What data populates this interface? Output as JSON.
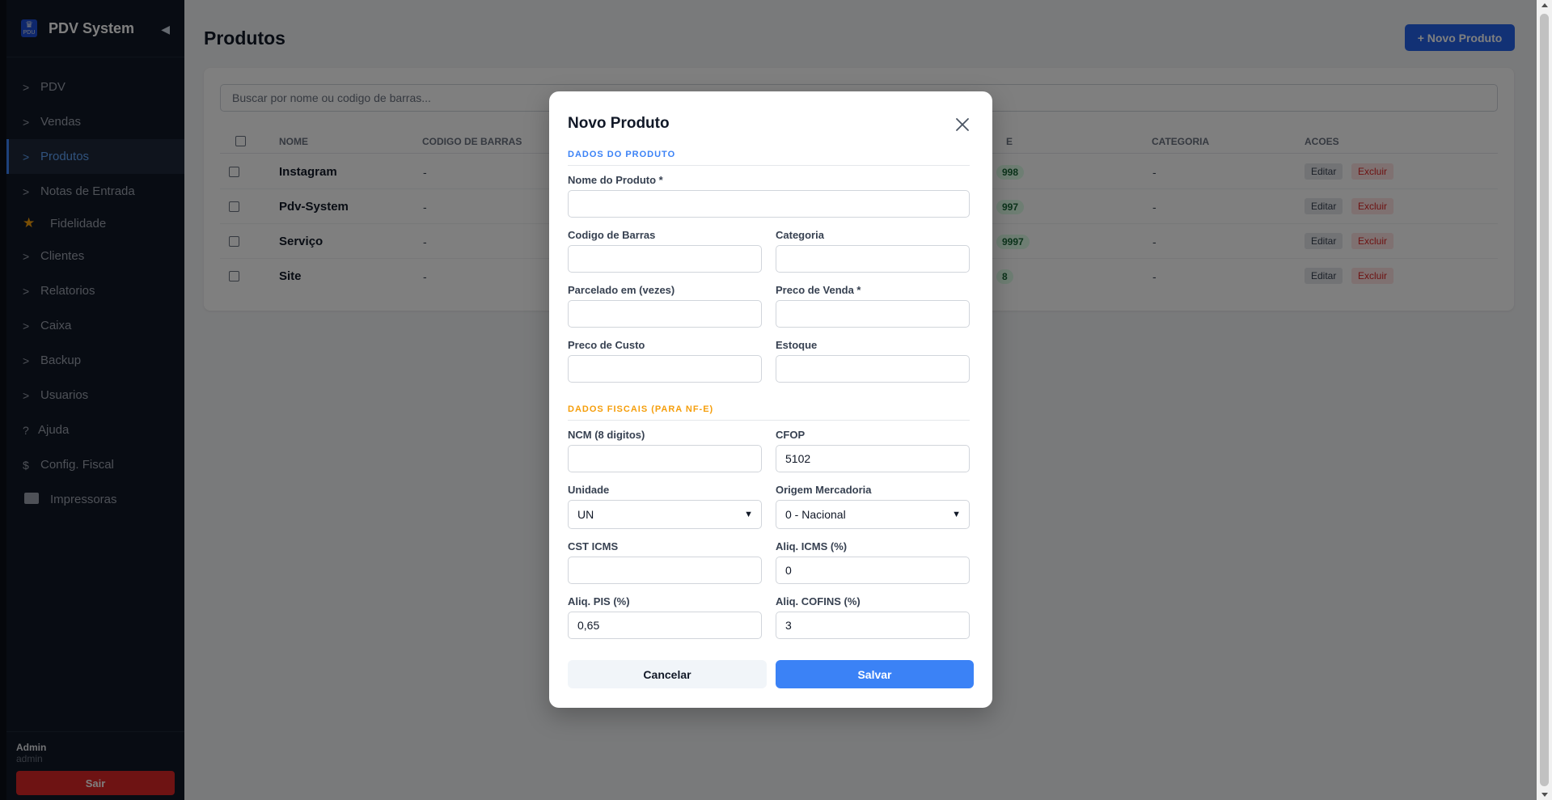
{
  "app": {
    "name": "PDV System",
    "logo_text": "PDU"
  },
  "sidebar": {
    "collapse_glyph": "◀",
    "items": [
      {
        "icon": ">",
        "label": "PDV"
      },
      {
        "icon": ">",
        "label": "Vendas"
      },
      {
        "icon": ">",
        "label": "Produtos",
        "active": true
      },
      {
        "icon": ">",
        "label": "Notas de Entrada"
      },
      {
        "icon": "★",
        "label": "Fidelidade"
      },
      {
        "icon": ">",
        "label": "Clientes"
      },
      {
        "icon": ">",
        "label": "Relatorios"
      },
      {
        "icon": ">",
        "label": "Caixa"
      },
      {
        "icon": ">",
        "label": "Backup"
      },
      {
        "icon": ">",
        "label": "Usuarios"
      },
      {
        "icon": "?",
        "label": "Ajuda"
      },
      {
        "icon": "$",
        "label": "Config. Fiscal"
      },
      {
        "icon": "printer-icon",
        "label": "Impressoras"
      }
    ],
    "user": {
      "name": "Admin",
      "role": "admin"
    },
    "logout_label": "Sair"
  },
  "main": {
    "title": "Produtos",
    "new_button": "+ Novo Produto",
    "search_placeholder": "Buscar por nome ou codigo de barras...",
    "columns": [
      "NOME",
      "CODIGO DE BARRAS",
      "E",
      "CATEGORIA",
      "ACOES"
    ],
    "rows": [
      {
        "name": "Instagram",
        "barcode": "-",
        "stock": "998",
        "category": "-"
      },
      {
        "name": "Pdv-System",
        "barcode": "-",
        "stock": "997",
        "category": "-"
      },
      {
        "name": "Serviço",
        "barcode": "-",
        "stock": "9997",
        "category": "-"
      },
      {
        "name": "Site",
        "barcode": "-",
        "stock": "8",
        "category": "-"
      }
    ],
    "edit_label": "Editar",
    "delete_label": "Excluir"
  },
  "modal": {
    "title": "Novo Produto",
    "section_product": "DADOS DO PRODUTO",
    "section_fiscal": "DADOS FISCAIS (PARA NF-E)",
    "fields": {
      "nome": {
        "label": "Nome do Produto *",
        "value": ""
      },
      "codigo": {
        "label": "Codigo de Barras",
        "value": ""
      },
      "categoria": {
        "label": "Categoria",
        "value": ""
      },
      "parcelado": {
        "label": "Parcelado em (vezes)",
        "value": ""
      },
      "preco_venda": {
        "label": "Preco de Venda *",
        "value": ""
      },
      "preco_custo": {
        "label": "Preco de Custo",
        "value": ""
      },
      "estoque": {
        "label": "Estoque",
        "value": ""
      },
      "ncm": {
        "label": "NCM (8 digitos)",
        "value": ""
      },
      "cfop": {
        "label": "CFOP",
        "value": "5102"
      },
      "unidade": {
        "label": "Unidade",
        "value": "UN"
      },
      "origem": {
        "label": "Origem Mercadoria",
        "value": "0 - Nacional"
      },
      "cst_icms": {
        "label": "CST ICMS",
        "value": ""
      },
      "aliq_icms": {
        "label": "Aliq. ICMS (%)",
        "value": "0"
      },
      "aliq_pis": {
        "label": "Aliq. PIS (%)",
        "value": "0,65"
      },
      "aliq_cofins": {
        "label": "Aliq. COFINS (%)",
        "value": "3"
      }
    },
    "cancel_label": "Cancelar",
    "save_label": "Salvar"
  },
  "colors": {
    "primary": "#3b82f6",
    "sidebar_bg": "#111827",
    "danger": "#dc2626",
    "fiscal_accent": "#f59e0b",
    "stock_badge_bg": "#dcfce7"
  }
}
